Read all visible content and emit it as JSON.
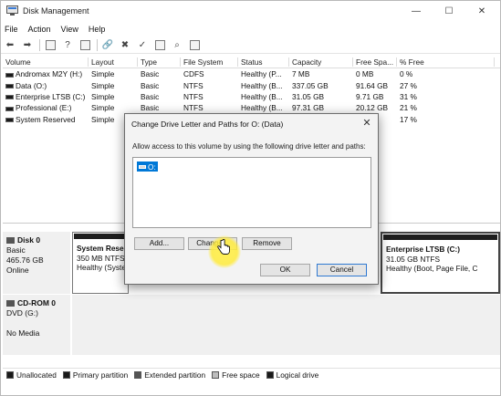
{
  "window": {
    "title": "Disk Management",
    "min": "—",
    "max": "☐",
    "close": "✕"
  },
  "menu": [
    "File",
    "Action",
    "View",
    "Help"
  ],
  "table": {
    "headers": [
      "Volume",
      "Layout",
      "Type",
      "File System",
      "Status",
      "Capacity",
      "Free Spa...",
      "% Free"
    ],
    "rows": [
      [
        "Andromax M2Y (H:)",
        "Simple",
        "Basic",
        "CDFS",
        "Healthy (P...",
        "7 MB",
        "0 MB",
        "0 %"
      ],
      [
        "Data (O:)",
        "Simple",
        "Basic",
        "NTFS",
        "Healthy (B...",
        "337.05 GB",
        "91.64 GB",
        "27 %"
      ],
      [
        "Enterprise LTSB (C:)",
        "Simple",
        "Basic",
        "NTFS",
        "Healthy (B...",
        "31.05 GB",
        "9.71 GB",
        "31 %"
      ],
      [
        "Professional (E:)",
        "Simple",
        "Basic",
        "NTFS",
        "Healthy (B...",
        "97.31 GB",
        "20.12 GB",
        "21 %"
      ],
      [
        "System Reserved",
        "Simple",
        "",
        "",
        "",
        "",
        "",
        "17 %"
      ]
    ]
  },
  "disks": {
    "disk0": {
      "name": "Disk 0",
      "type": "Basic",
      "size": "465.76 GB",
      "state": "Online"
    },
    "cdrom": {
      "name": "CD-ROM 0",
      "type": "DVD (G:)",
      "state": "No Media"
    },
    "part_sysres": {
      "name": "System Rese",
      "size": "350 MB NTFS",
      "status": "Healthy (Syste"
    },
    "part_ltsb": {
      "name": "Enterprise LTSB  (C:)",
      "size": "31.05 GB NTFS",
      "status": "Healthy (Boot, Page File, C"
    }
  },
  "legend": [
    "Unallocated",
    "Primary partition",
    "Extended partition",
    "Free space",
    "Logical drive"
  ],
  "legend_colors": [
    "#1a1a1a",
    "#1a1a1a",
    "#555555",
    "#bdbdbd",
    "#1a1a1a"
  ],
  "dialog": {
    "title": "Change Drive Letter and Paths for O: (Data)",
    "close": "✕",
    "description": "Allow access to this volume by using the following drive letter and paths:",
    "entry": "O:",
    "add": "Add...",
    "change": "Change...",
    "remove": "Remove",
    "ok": "OK",
    "cancel": "Cancel"
  }
}
